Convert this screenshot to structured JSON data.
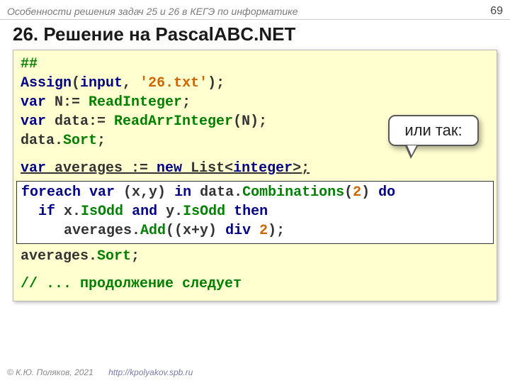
{
  "header": {
    "subtitle": "Особенности решения задач 25 и 26 в КЕГЭ по информатике",
    "pageNumber": "69"
  },
  "title": "26. Решение на PascalABC.NET",
  "callout": "или так:",
  "code": {
    "l1_hash": "##",
    "l2_assign": "Assign",
    "l2_open": "(",
    "l2_input": "input",
    "l2_comma": ", ",
    "l2_str": "'26.txt'",
    "l2_close": ");",
    "l3_var": "var",
    "l3_n": " N:= ",
    "l3_read": "ReadInteger",
    "l3_sc": ";",
    "l4_var": "var",
    "l4_data": " data:= ",
    "l4_read": "ReadArrInteger",
    "l4_tail": "(N);",
    "l5_data": "data.",
    "l5_sort": "Sort",
    "l5_sc": ";",
    "l6_var": "var",
    "l6_av": " averages := ",
    "l6_new": "new",
    "l6_list": " List<",
    "l6_int": "integer",
    "l6_tail": ">;",
    "box_l1_foreach": "foreach",
    "box_l1_sp1": " ",
    "box_l1_var": "var",
    "box_l1_xy": " (x,y) ",
    "box_l1_in": "in",
    "box_l1_data": " data.",
    "box_l1_comb": "Combinations",
    "box_l1_paren": "(",
    "box_l1_two": "2",
    "box_l1_close": ") ",
    "box_l1_do": "do",
    "box_l2_indent": "  ",
    "box_l2_if": "if",
    "box_l2_x": " x.",
    "box_l2_isodd1": "IsOdd",
    "box_l2_sp2": " ",
    "box_l2_and": "and",
    "box_l2_y": " y.",
    "box_l2_isodd2": "IsOdd",
    "box_l2_sp3": " ",
    "box_l2_then": "then",
    "box_l3_indent": "     averages.",
    "box_l3_add": "Add",
    "box_l3_expr1": "((x+y) ",
    "box_l3_div": "div",
    "box_l3_expr2": " ",
    "box_l3_two": "2",
    "box_l3_close": ");",
    "l7_av": "averages.",
    "l7_sort": "Sort",
    "l7_sc": ";",
    "l8_comment": "// ... продолжение следует"
  },
  "footer": {
    "copyright": "© К.Ю. Поляков, 2021",
    "url": "http://kpolyakov.spb.ru"
  }
}
